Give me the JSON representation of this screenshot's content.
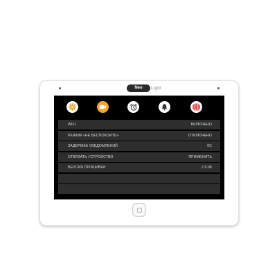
{
  "device": {
    "brand_prefix": "Neo",
    "brand_suffix": "Light"
  },
  "tabs": [
    {
      "icon": "gear-icon",
      "color": "#f5a623"
    },
    {
      "icon": "camera-icon",
      "color": "#f5a623"
    },
    {
      "icon": "alarm-clock-icon",
      "color": "#ffffff"
    },
    {
      "icon": "bell-icon",
      "color": "#ffffff"
    },
    {
      "icon": "globe-icon",
      "color": "#e8262a"
    }
  ],
  "settings": [
    {
      "label": "WIFI",
      "value": "ВКЛЮЧЕНО"
    },
    {
      "label": "РЕЖИМ «НЕ БЕСПОКОИТЬ»",
      "value": "ОТКЛЮЧЕНО"
    },
    {
      "label": "ЗАДЕРЖКА УВЕДОМЛЕНИЙ",
      "value": "0С"
    },
    {
      "label": "ОТВЯЗАТЬ УСТРОЙСТВО",
      "value": "ПРИМЕНИТЬ"
    },
    {
      "label": "ВЕРСИЯ ПРОШИВКИ",
      "value": "2.9.06"
    },
    {
      "label": "",
      "value": ""
    },
    {
      "label": "",
      "value": ""
    }
  ],
  "colors": {
    "screen_bg": "#000000",
    "row_bg": "#2e2e2e",
    "accent": "#f5a623"
  }
}
